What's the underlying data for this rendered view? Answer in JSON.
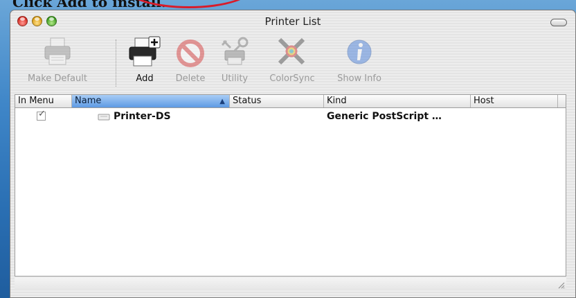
{
  "caption": "Click Add to install.",
  "window": {
    "title": "Printer List"
  },
  "toolbar": {
    "make_default": "Make Default",
    "add": "Add",
    "delete": "Delete",
    "utility": "Utility",
    "colorsync": "ColorSync",
    "show_info": "Show Info"
  },
  "table": {
    "columns": {
      "in_menu": "In Menu",
      "name": "Name",
      "status": "Status",
      "kind": "Kind",
      "host": "Host"
    },
    "sort_arrow": "▲",
    "rows": [
      {
        "in_menu": "✓",
        "name": "Printer-DS",
        "status": "",
        "kind": "Generic PostScript …",
        "host": ""
      }
    ]
  },
  "colors": {
    "close": "#d52a20",
    "minimize": "#d79a12",
    "zoom": "#3d9a1f",
    "sorted_header": "#5e9ae4",
    "annotation": "#d81c2a"
  },
  "icons": [
    "printer-icon",
    "add-printer-icon",
    "delete-icon",
    "utility-icon",
    "colorsync-icon",
    "info-icon"
  ]
}
